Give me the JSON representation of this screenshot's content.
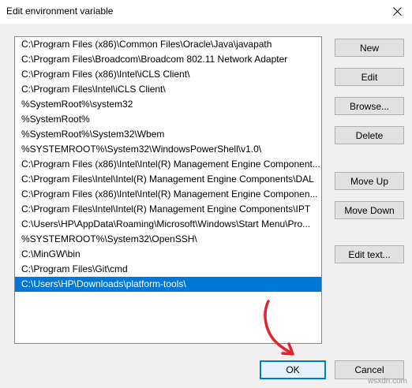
{
  "window": {
    "title": "Edit environment variable",
    "close_icon": "close-icon"
  },
  "path_list": {
    "items": [
      "C:\\Program Files (x86)\\Common Files\\Oracle\\Java\\javapath",
      "C:\\Program Files\\Broadcom\\Broadcom 802.11 Network Adapter",
      "C:\\Program Files (x86)\\Intel\\iCLS Client\\",
      "C:\\Program Files\\Intel\\iCLS Client\\",
      "%SystemRoot%\\system32",
      "%SystemRoot%",
      "%SystemRoot%\\System32\\Wbem",
      "%SYSTEMROOT%\\System32\\WindowsPowerShell\\v1.0\\",
      "C:\\Program Files (x86)\\Intel\\Intel(R) Management Engine Component...",
      "C:\\Program Files\\Intel\\Intel(R) Management Engine Components\\DAL",
      "C:\\Program Files (x86)\\Intel\\Intel(R) Management Engine Componen...",
      "C:\\Program Files\\Intel\\Intel(R) Management Engine Components\\IPT",
      "C:\\Users\\HP\\AppData\\Roaming\\Microsoft\\Windows\\Start Menu\\Pro...",
      "%SYSTEMROOT%\\System32\\OpenSSH\\",
      "C:\\MinGW\\bin",
      "C:\\Program Files\\Git\\cmd",
      "C:\\Users\\HP\\Downloads\\platform-tools\\"
    ],
    "selected_index": 16
  },
  "buttons": {
    "new": "New",
    "edit": "Edit",
    "browse": "Browse...",
    "delete": "Delete",
    "move_up": "Move Up",
    "move_down": "Move Down",
    "edit_text": "Edit text...",
    "ok": "OK",
    "cancel": "Cancel"
  },
  "watermark": "wsxdn.com",
  "colors": {
    "selection": "#0078d7",
    "annotation_arrow": "#e0242c"
  }
}
